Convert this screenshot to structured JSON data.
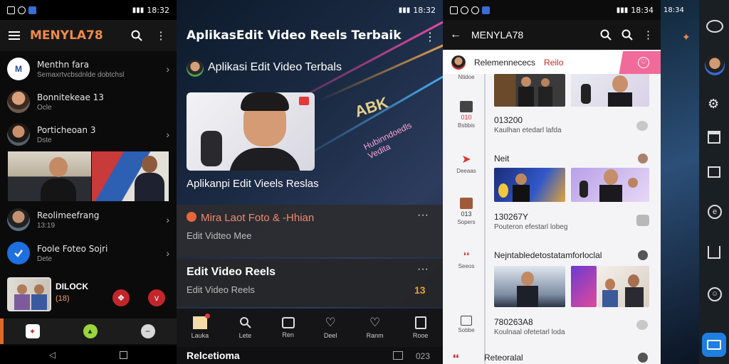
{
  "colors": {
    "accent_orange": "#f08a4b",
    "accent_red": "#e23a3a",
    "accent_pink": "#f06a9a",
    "accent_green": "#9bd43c",
    "accent_blue": "#1e7fe0"
  },
  "panel1": {
    "status_time": "18:32",
    "title": "MENYLA78",
    "rows": [
      {
        "title": "Menthn fara",
        "sub": "Semaxrtvcbsdnlde dobtchsl"
      },
      {
        "title": "Bonnitekeae 13",
        "sub": "Ocle"
      },
      {
        "title": "Porticheoan 3",
        "sub": "Dste"
      },
      {
        "title": "Reolimeefrang",
        "sub": "13:19"
      },
      {
        "title": "Foole Foteo Sojri",
        "sub": "Dete"
      }
    ],
    "bottom_card": {
      "title": "DILOCK",
      "sub": "(18)"
    },
    "nav_icons": [
      "cube-icon",
      "triangle-icon",
      "minus-icon"
    ]
  },
  "panel2": {
    "status_time": "18:32",
    "header_title": "AplikasEdit Video Reels Terbaik",
    "sub_title": "Aplikasi Edit Video Terbals",
    "hero_caption": "Aplikanpi Edit Vieels Reslas",
    "overlay_text_1": "ABK",
    "overlay_text_2": "Hubinndoedls Vedita",
    "card1": {
      "title": "Mira Laot Foto & -Hhian",
      "sub": "Edit Vidteo Mee"
    },
    "card2": {
      "title": "Edit Video Reels",
      "sub": "Edit Video Reels",
      "badge": "13"
    },
    "nav": [
      {
        "label": "Lauka",
        "icon": "home-icon"
      },
      {
        "label": "Lete",
        "icon": "person-icon"
      },
      {
        "label": "Ren",
        "icon": "square-icon"
      },
      {
        "label": "Deel",
        "icon": "heart-icon"
      },
      {
        "label": "Ranm",
        "icon": "heart-icon"
      },
      {
        "label": "Rooe",
        "icon": "box-icon"
      }
    ],
    "footer": {
      "label": "Relcetioma",
      "num": "023"
    }
  },
  "panel3": {
    "status_time": "18:34",
    "title": "MENYLA78",
    "tabs": {
      "label": "Relemennececs",
      "active": "Reilo"
    },
    "categories": [
      {
        "label": "Ntidoe",
        "num": ""
      },
      {
        "label": "Bsbbis",
        "num": "010"
      },
      {
        "label": "Deeaas",
        "num": ""
      },
      {
        "label": "Sopers",
        "num": "013"
      },
      {
        "label": "Seeos",
        "num": ""
      },
      {
        "label": "Sobbe",
        "num": ""
      }
    ],
    "entries": [
      {
        "title": "013200",
        "sub": "Kaulhan etedarl lafda"
      },
      {
        "title": "Neit",
        "sub": ""
      },
      {
        "title": "130267Y",
        "sub": "Pouteron efestarl lobeg"
      },
      {
        "title": "Nejntabledetostatamforloclal",
        "sub": ""
      },
      {
        "title": "780263A8",
        "sub": "Koulnaal ofetetarl loda"
      },
      {
        "title": "Reteoralal",
        "sub": ""
      }
    ]
  },
  "panel4": {
    "status_time": "18:34",
    "rail_icons": [
      "share-icon",
      "avatar",
      "settings-icon",
      "window-icon",
      "message-icon",
      "e-icon",
      "box-icon",
      "smile-icon",
      "translate-icon"
    ]
  }
}
